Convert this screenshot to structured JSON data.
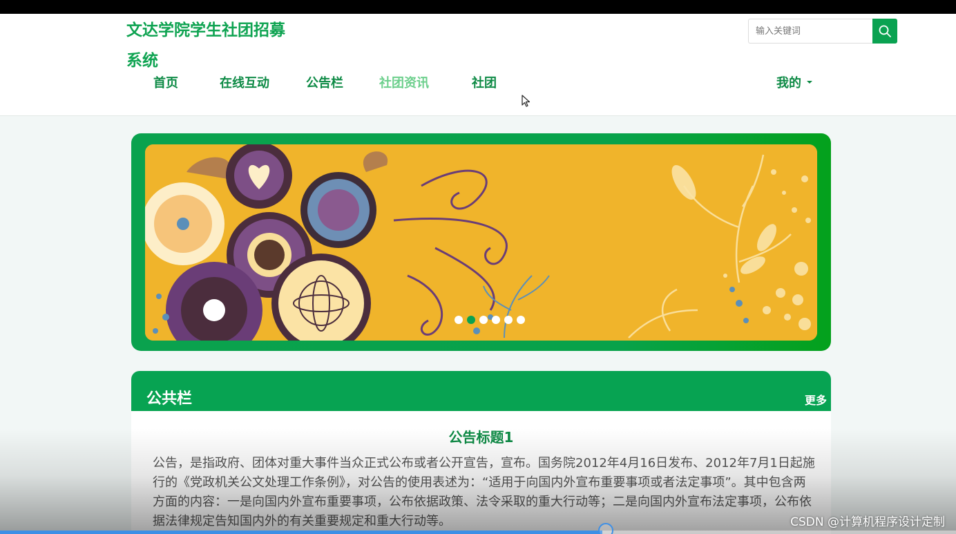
{
  "site": {
    "title": "文达学院学生社团招募系统"
  },
  "search": {
    "placeholder": "输入关键词"
  },
  "nav": {
    "items": [
      {
        "label": "首页"
      },
      {
        "label": "在线互动"
      },
      {
        "label": "公告栏"
      },
      {
        "label": "社团资讯",
        "active": true
      },
      {
        "label": "社团"
      }
    ],
    "user_menu": "我的"
  },
  "carousel": {
    "slide_count": 6,
    "active_index": 1
  },
  "board": {
    "title": "公共栏",
    "more": "更多",
    "notice_title": "公告标题1",
    "notice_body": "公告，是指政府、团体对重大事件当众正式公布或者公开宣告，宣布。国务院2012年4月16日发布、2012年7月1日起施行的《党政机关公文处理工作条例》，对公告的使用表述为：“适用于向国内外宣布重要事项或者法定事项”。其中包含两方面的内容：一是向国内外宣布重要事项，公布依据政策、法令采取的重大行动等；二是向国内外宣布法定事项，公布依据法律规定告知国内外的有关重要规定和重大行动等。"
  },
  "video": {
    "progress": 0.63
  },
  "watermark": "CSDN @计算机程序设计定制",
  "colors": {
    "brand": "#0aa251",
    "banner_bg": "#f0b42b",
    "text": "#555555"
  }
}
